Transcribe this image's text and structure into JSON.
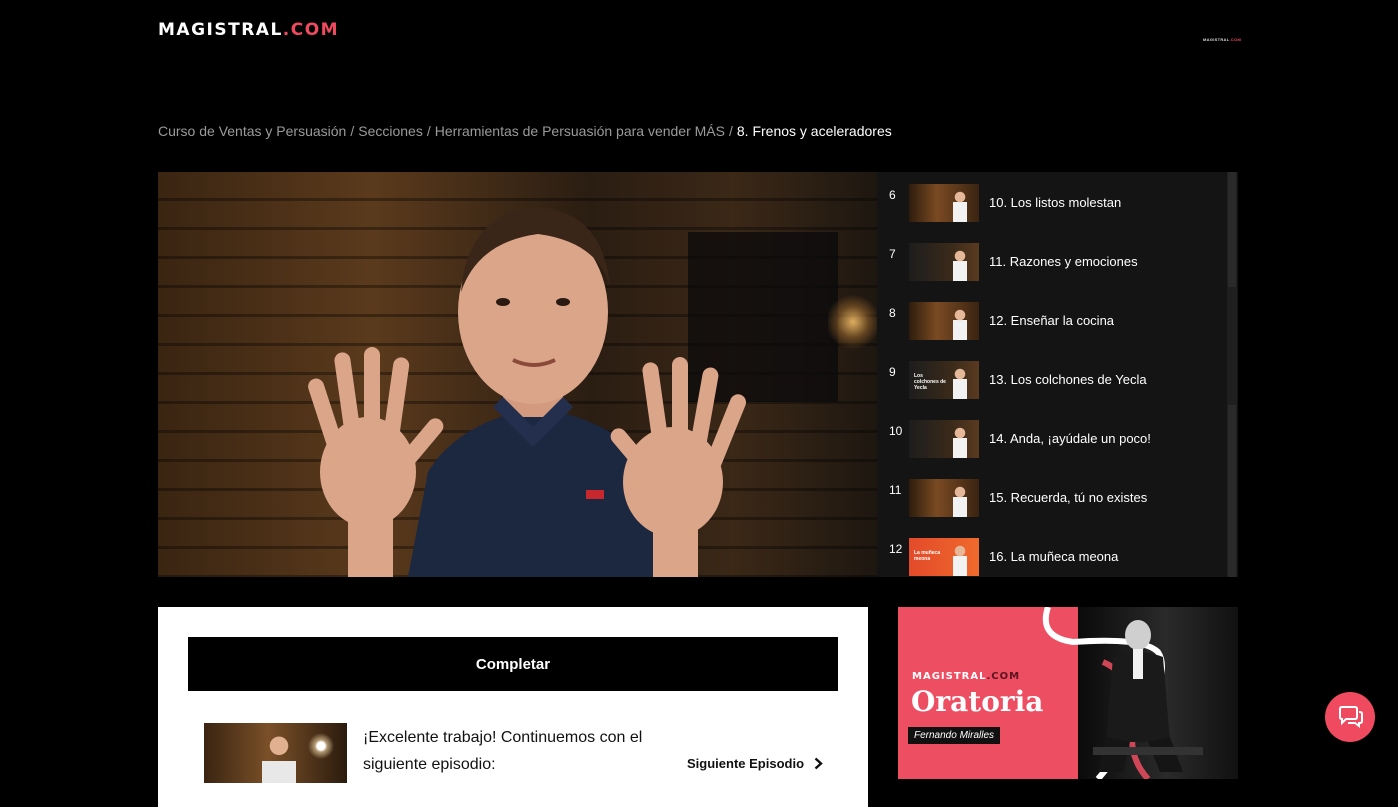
{
  "header": {
    "logo_main": "MAGISTRAL",
    "logo_accent": ".COM"
  },
  "breadcrumb": {
    "items": [
      "Curso de Ventas y Persuasión",
      "Secciones",
      "Herramientas de Persuasión para vender MÁS"
    ],
    "current": "8. Frenos y aceleradores",
    "separator": "/"
  },
  "episodes": [
    {
      "num": "6",
      "title": "10. Los listos molestan",
      "thumb_text": ""
    },
    {
      "num": "7",
      "title": "11. Razones y emociones",
      "thumb_text": ""
    },
    {
      "num": "8",
      "title": "12. Enseñar la cocina",
      "thumb_text": ""
    },
    {
      "num": "9",
      "title": "13. Los colchones de Yecla",
      "thumb_text": "Los colchones de Yecla"
    },
    {
      "num": "10",
      "title": "14. Anda, ¡ayúdale un poco!",
      "thumb_text": ""
    },
    {
      "num": "11",
      "title": "15. Recuerda, tú no existes",
      "thumb_text": ""
    },
    {
      "num": "12",
      "title": "16. La muñeca meona",
      "thumb_text": "La muñeca meona"
    }
  ],
  "card": {
    "complete_label": "Completar",
    "next_message": "¡Excelente trabajo! Continuemos con el siguiente episodio:",
    "next_label": "Siguiente Episodio"
  },
  "promo": {
    "brand_main": "MAGISTRAL",
    "brand_accent": ".COM",
    "course": "Oratoria",
    "author": "Fernando Miralles"
  },
  "icons": {
    "next": "chevron-right-icon",
    "chat": "chat-icon"
  },
  "colors": {
    "accent": "#ef4a5f",
    "background": "#000000",
    "list_bg": "#141414"
  }
}
